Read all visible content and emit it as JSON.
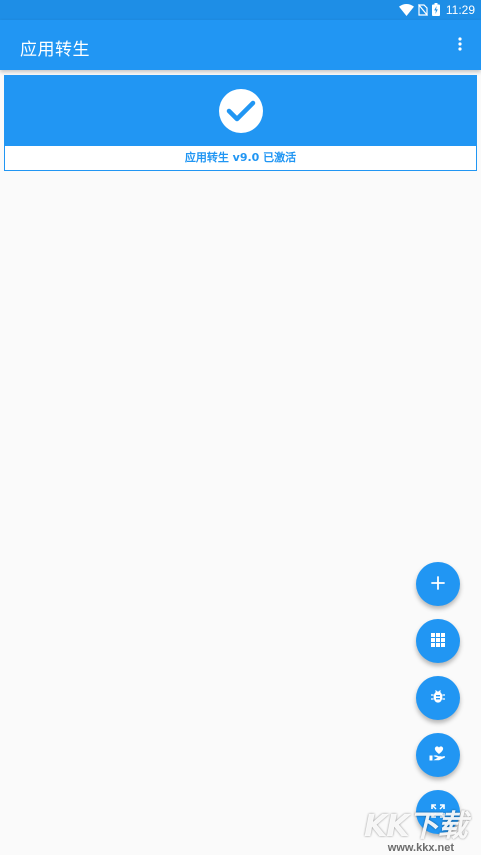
{
  "status_bar": {
    "time": "11:29",
    "icons": [
      "wifi-icon",
      "no-sim-icon",
      "battery-charging-icon"
    ]
  },
  "app_bar": {
    "title": "应用转生",
    "overflow_icon": "more-vert-icon"
  },
  "status_card": {
    "icon": "check-circle-icon",
    "text": "应用转生 v9.0 已激活"
  },
  "fabs": [
    {
      "name": "add-button",
      "icon": "plus-icon"
    },
    {
      "name": "apps-button",
      "icon": "grid-icon"
    },
    {
      "name": "debug-button",
      "icon": "bug-icon"
    },
    {
      "name": "donate-button",
      "icon": "hand-heart-icon"
    },
    {
      "name": "expand-button",
      "icon": "fullscreen-icon"
    }
  ],
  "watermark": {
    "logo": "KK下载",
    "url": "www.kkx.net"
  },
  "colors": {
    "primary": "#2196f3",
    "status_bar": "#1e8ee6",
    "background": "#fafafa",
    "on_primary": "#ffffff"
  }
}
